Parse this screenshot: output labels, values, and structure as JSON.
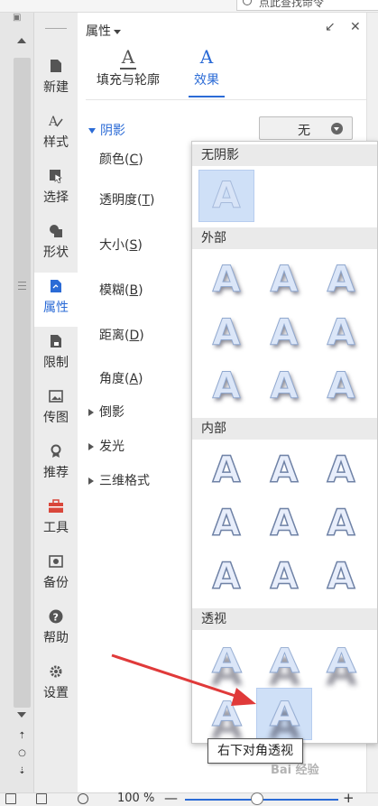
{
  "header": {
    "search_text": "点此查找命令"
  },
  "nav": {
    "items": [
      {
        "key": "new",
        "label": "新建",
        "icon": "doc-icon"
      },
      {
        "key": "style",
        "label": "样式",
        "icon": "style-icon"
      },
      {
        "key": "select",
        "label": "选择",
        "icon": "cursor-icon"
      },
      {
        "key": "shape",
        "label": "形状",
        "icon": "shape-icon"
      },
      {
        "key": "props",
        "label": "属性",
        "icon": "properties-icon"
      },
      {
        "key": "limit",
        "label": "限制",
        "icon": "lock-doc-icon"
      },
      {
        "key": "picture",
        "label": "传图",
        "icon": "image-icon"
      },
      {
        "key": "recommend",
        "label": "推荐",
        "icon": "badge-icon"
      },
      {
        "key": "tools",
        "label": "工具",
        "icon": "toolbox-icon"
      },
      {
        "key": "backup",
        "label": "备份",
        "icon": "backup-icon"
      },
      {
        "key": "help",
        "label": "帮助",
        "icon": "help-icon"
      },
      {
        "key": "settings",
        "label": "设置",
        "icon": "gear-icon"
      }
    ]
  },
  "panel": {
    "title": "属性",
    "tabs": [
      {
        "label": "填充与轮廓",
        "icon_glyph": "A"
      },
      {
        "label": "效果",
        "icon_glyph": "A"
      }
    ],
    "shadow_section": "阴影",
    "dropdown_value": "无",
    "props": [
      {
        "label": "颜色(",
        "key": "C",
        "tail": ")"
      },
      {
        "label": "透明度(",
        "key": "T",
        "tail": ")"
      },
      {
        "label": "大小(",
        "key": "S",
        "tail": ")"
      },
      {
        "label": "模糊(",
        "key": "B",
        "tail": ")"
      },
      {
        "label": "距离(",
        "key": "D",
        "tail": ")"
      },
      {
        "label": "角度(",
        "key": "A",
        "tail": ")"
      }
    ],
    "collapsed_sections": [
      "倒影",
      "发光",
      "三维格式"
    ]
  },
  "popup": {
    "groups": [
      {
        "title": "无阴影",
        "count": 1
      },
      {
        "title": "外部",
        "count": 9
      },
      {
        "title": "内部",
        "count": 9
      },
      {
        "title": "透视",
        "count": 5
      }
    ],
    "tile_glyph": "A",
    "tooltip": "右下对角透视"
  },
  "status": {
    "zoom": "100 %"
  },
  "watermark": "Bai 经验",
  "colors": {
    "accent": "#2b6bd6",
    "arrow": "#e03a3a"
  }
}
